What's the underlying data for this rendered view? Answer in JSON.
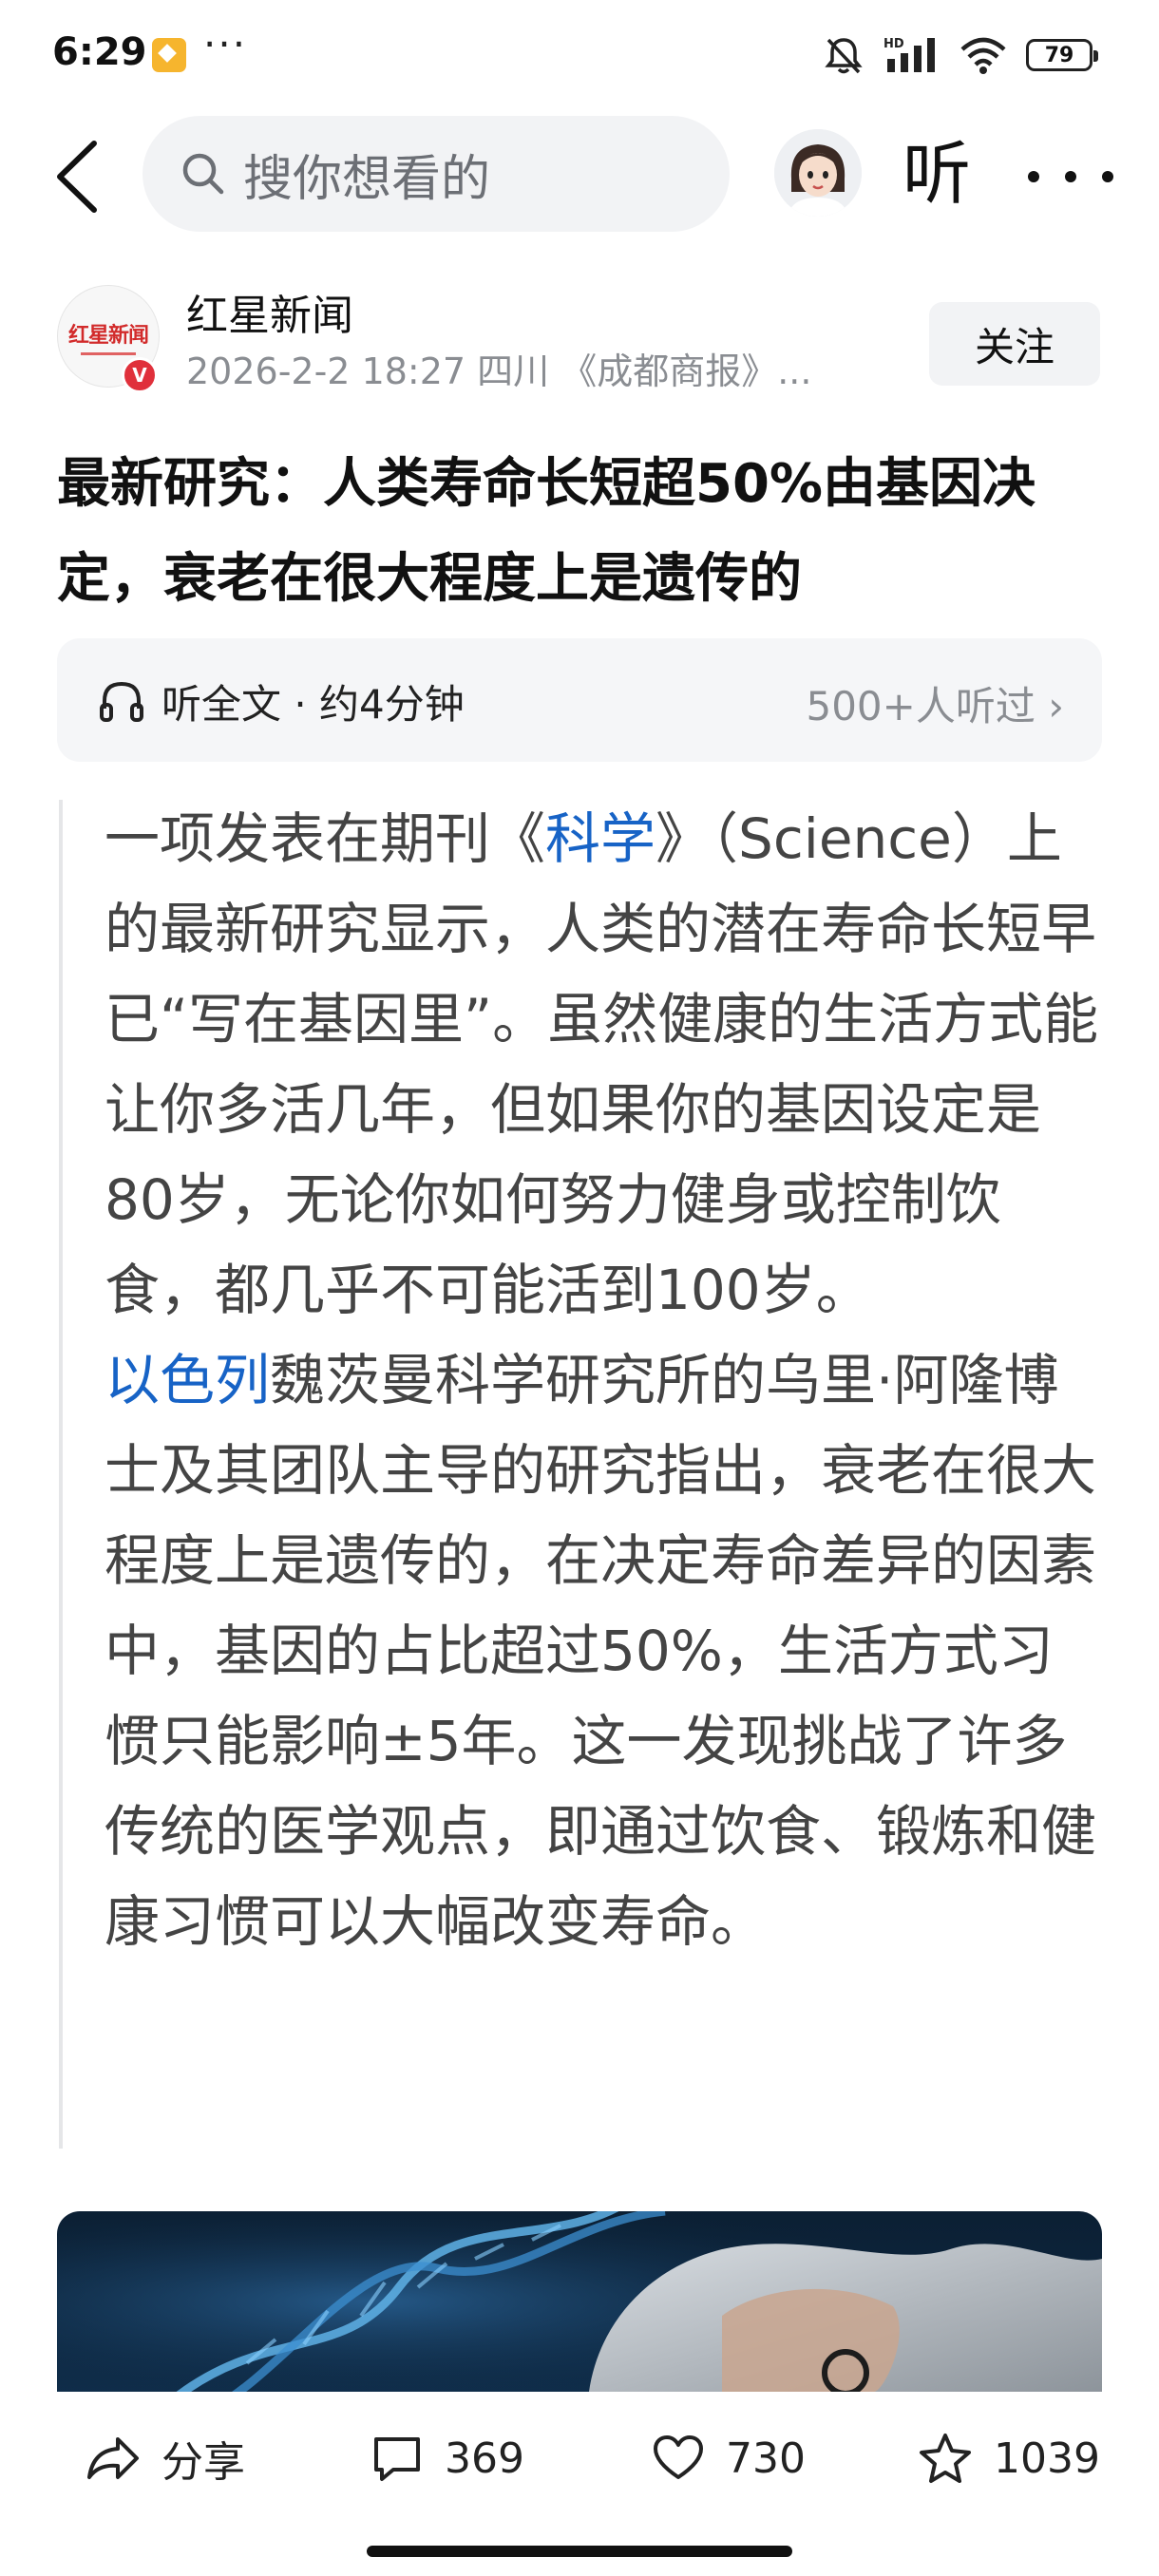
{
  "status_bar": {
    "time": "6:29",
    "more": "···",
    "network": "HD",
    "battery": "79"
  },
  "nav": {
    "search_placeholder": "搜你想看的",
    "listen_label": "听"
  },
  "author": {
    "name": "红星新闻",
    "logo_text": "红星新闻",
    "meta": "2026-2-2 18:27 四川 《成都商报》...",
    "verified": "V",
    "follow_label": "关注"
  },
  "article": {
    "title": "最新研究：人类寿命长短超50%由基因决定，衰老在很大程度上是遗传的",
    "listen_card": {
      "label": "听全文 · 约4分钟",
      "count": "500+人听过 ›"
    },
    "paragraph1": {
      "before_link": "一项发表在期刊《",
      "link": "科学",
      "after_link": "》（Science）上的最新研究显示，人类的潜在寿命长短早已“写在基因里”。虽然健康的生活方式能让你多活几年，但如果你的基因设定是80岁，无论你如何努力健身或控制饮食，都几乎不可能活到100岁。"
    },
    "paragraph2": {
      "link": "以色列",
      "after_link": "魏茨曼科学研究所的乌里·阿隆博士及其团队主导的研究指出，衰老在很大程度上是遗传的，在决定寿命差异的因素中，基因的占比超过50%，生活方式习惯只能影响±5年。这一发现挑战了许多传统的医学观点，即通过饮食、锻炼和健康习惯可以大幅改变寿命。"
    }
  },
  "actions": {
    "share": "分享",
    "comments": "369",
    "likes": "730",
    "favorites": "1039"
  }
}
